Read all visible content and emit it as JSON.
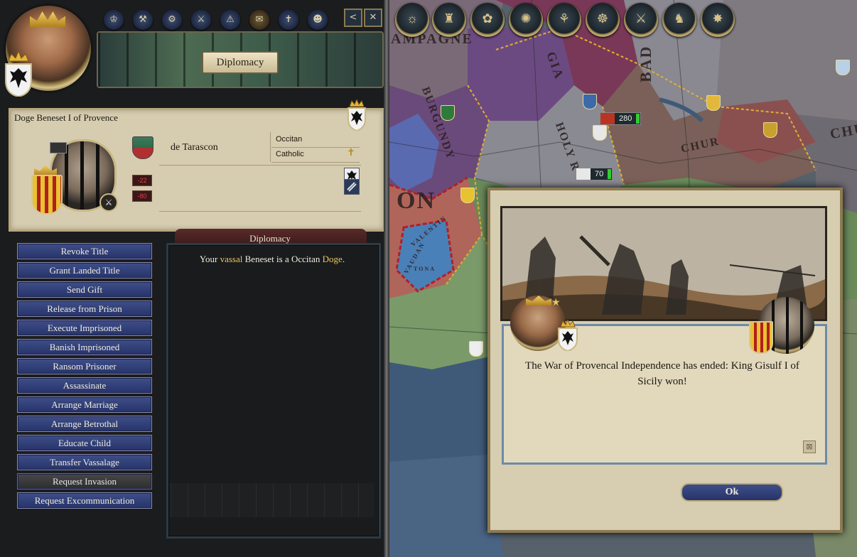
{
  "window": {
    "panel_title": "Diplomacy",
    "tabs": [
      "realm-tab",
      "law-tab",
      "technology-tab",
      "military-tab",
      "intrigue-tab",
      "diplomacy-tab",
      "religion-tab",
      "character-finder-tab"
    ],
    "tab_glyphs": [
      "♔",
      "⚒",
      "⚙",
      "⚔",
      "⚠",
      "✉",
      "✝",
      "☻"
    ],
    "back_glyph": "<",
    "close_glyph": "✕"
  },
  "character": {
    "name": "Doge Beneset I of Provence",
    "dynasty": "de Tarascon",
    "culture": "Occitan",
    "religion": "Catholic",
    "religion_glyph": "✝",
    "opinions": [
      "-22",
      "-80"
    ]
  },
  "detail": {
    "title": "Diplomacy",
    "text_parts": [
      "Your ",
      "vassal",
      " Beneset is a Occitan ",
      "Doge",
      "."
    ]
  },
  "actions": [
    {
      "label": "Revoke Title",
      "enabled": true
    },
    {
      "label": "Grant Landed Title",
      "enabled": true
    },
    {
      "label": "Send Gift",
      "enabled": true
    },
    {
      "label": "Release from Prison",
      "enabled": true
    },
    {
      "label": "Execute Imprisoned",
      "enabled": true
    },
    {
      "label": "Banish Imprisoned",
      "enabled": true
    },
    {
      "label": "Ransom Prisoner",
      "enabled": true
    },
    {
      "label": "Assassinate",
      "enabled": true
    },
    {
      "label": "Arrange Marriage",
      "enabled": true
    },
    {
      "label": "Arrange Betrothal",
      "enabled": true
    },
    {
      "label": "Educate Child",
      "enabled": true
    },
    {
      "label": "Transfer Vassalage",
      "enabled": true
    },
    {
      "label": "Request Invasion",
      "enabled": false
    },
    {
      "label": "Request Excommunication",
      "enabled": true
    }
  ],
  "map": {
    "labels": [
      "AMPAGNE",
      "BURGUNDY",
      "HOLY R",
      "GIA",
      "BAD",
      "ON",
      "CHUR",
      "CHU",
      "VALENTIN",
      "VAUDAN",
      "TONA"
    ],
    "armies": [
      {
        "size": "280"
      },
      {
        "size": "70"
      }
    ],
    "top_glyphs": [
      "☼",
      "♜",
      "✿",
      "✺",
      "⚘",
      "☸",
      "⚔",
      "♞",
      "✸"
    ]
  },
  "dialog": {
    "message": "The War of Provencal Independence has ended: King Gisulf I of Sicily won!",
    "ok_label": "Ok",
    "corner_glyph": "⊠"
  },
  "colors": {
    "action_button": "#3e4e88",
    "highlight_text": "#e8c860",
    "dialog_border": "#6d8aa8",
    "army_strength": "#33cc33",
    "opinion_negative": "#e34040"
  }
}
